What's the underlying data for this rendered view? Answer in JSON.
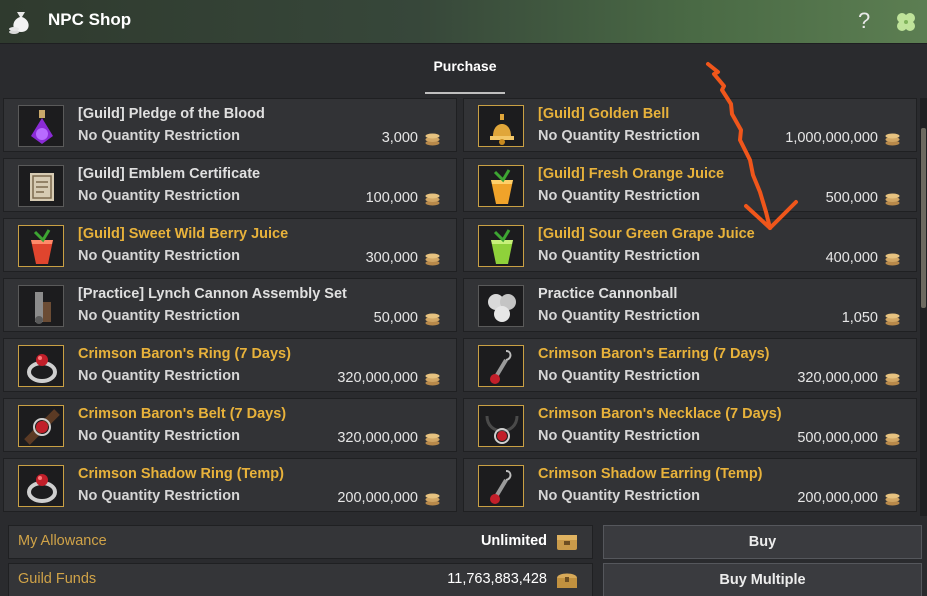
{
  "window": {
    "title": "NPC Shop",
    "help_label": "?"
  },
  "tabs": [
    {
      "label": "Purchase"
    }
  ],
  "items": [
    {
      "name": "[Guild] Pledge of the Blood",
      "restriction": "No Quantity Restriction",
      "price": "3,000",
      "highlight": false,
      "icon": "purple-potion-icon"
    },
    {
      "name": "[Guild] Golden Bell",
      "restriction": "No Quantity Restriction",
      "price": "1,000,000,000",
      "highlight": true,
      "icon": "golden-bell-icon"
    },
    {
      "name": "[Guild] Emblem Certificate",
      "restriction": "No Quantity Restriction",
      "price": "100,000",
      "highlight": false,
      "icon": "certificate-icon"
    },
    {
      "name": "[Guild] Fresh Orange Juice",
      "restriction": "No Quantity Restriction",
      "price": "500,000",
      "highlight": true,
      "icon": "orange-juice-icon"
    },
    {
      "name": "[Guild] Sweet Wild Berry Juice",
      "restriction": "No Quantity Restriction",
      "price": "300,000",
      "highlight": true,
      "icon": "berry-juice-icon"
    },
    {
      "name": "[Guild] Sour Green Grape Juice",
      "restriction": "No Quantity Restriction",
      "price": "400,000",
      "highlight": true,
      "icon": "grape-juice-icon"
    },
    {
      "name": "[Practice] Lynch Cannon Assembly Set",
      "restriction": "No Quantity Restriction",
      "price": "50,000",
      "highlight": false,
      "icon": "cannon-set-icon"
    },
    {
      "name": "Practice Cannonball",
      "restriction": "No Quantity Restriction",
      "price": "1,050",
      "highlight": false,
      "icon": "cannonball-icon"
    },
    {
      "name": "Crimson Baron's Ring (7 Days)",
      "restriction": "No Quantity Restriction",
      "price": "320,000,000",
      "highlight": true,
      "icon": "ring-icon"
    },
    {
      "name": "Crimson Baron's Earring (7 Days)",
      "restriction": "No Quantity Restriction",
      "price": "320,000,000",
      "highlight": true,
      "icon": "earring-icon"
    },
    {
      "name": "Crimson Baron's Belt (7 Days)",
      "restriction": "No Quantity Restriction",
      "price": "320,000,000",
      "highlight": true,
      "icon": "belt-icon"
    },
    {
      "name": "Crimson Baron's Necklace (7 Days)",
      "restriction": "No Quantity Restriction",
      "price": "500,000,000",
      "highlight": true,
      "icon": "necklace-icon"
    },
    {
      "name": "Crimson Shadow Ring (Temp)",
      "restriction": "No Quantity Restriction",
      "price": "200,000,000",
      "highlight": true,
      "icon": "ring-icon"
    },
    {
      "name": "Crimson Shadow Earring (Temp)",
      "restriction": "No Quantity Restriction",
      "price": "200,000,000",
      "highlight": true,
      "icon": "earring-icon"
    }
  ],
  "footer": {
    "allowance_label": "My Allowance",
    "allowance_value": "Unlimited",
    "funds_label": "Guild Funds",
    "funds_value": "11,763,883,428",
    "buy_label": "Buy",
    "buy_multiple_label": "Buy Multiple"
  },
  "colors": {
    "highlight_text": "#e8b23b",
    "annotation_arrow": "#f0561b"
  }
}
